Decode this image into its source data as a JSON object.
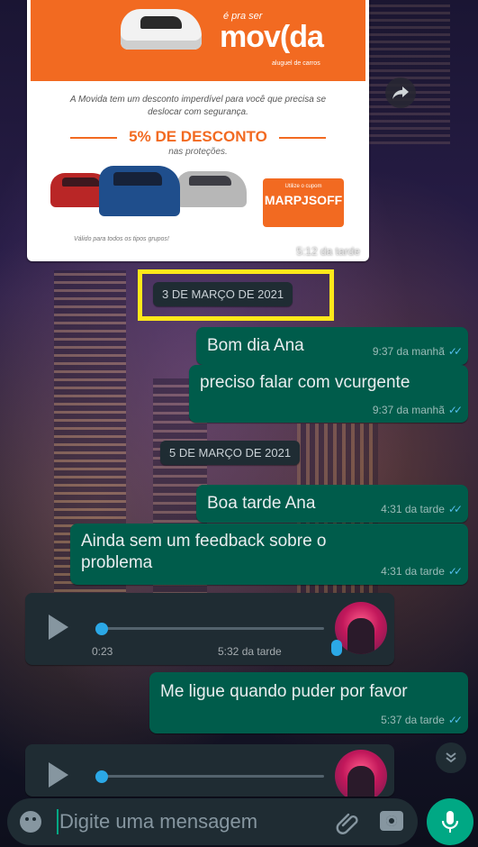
{
  "colors": {
    "outgoing_bubble": "#005c4b",
    "incoming_bubble": "#1f2c33",
    "read_ticks": "#53bdeb",
    "accent_green": "#00a884",
    "highlight_box": "#ffe81a",
    "ad_orange": "#f26a21"
  },
  "image_message": {
    "ad": {
      "tagline": "é pra ser",
      "brand": "mov(da",
      "brand_sub": "aluguel de carros",
      "text": "A Movida tem um desconto imperdível para você que precisa se deslocar com segurança.",
      "discount": "5% DE DESCONTO",
      "discount_sub": "nas proteções.",
      "coupon_small": "Utilize o cupom",
      "coupon_code": "MARPJSOFF",
      "footnote": "Válido para todos os tipos grupos!"
    },
    "time": "5:12 da tarde",
    "forward_icon": "forward-arrow-icon"
  },
  "chat": {
    "date_1": "3 DE MARÇO DE 2021",
    "date_2": "5 DE MARÇO DE 2021",
    "messages": [
      {
        "text": "Bom dia Ana",
        "time": "9:37 da manhã"
      },
      {
        "text": "preciso falar com vcurgente",
        "time": "9:37 da manhã"
      },
      {
        "text": "Boa tarde Ana",
        "time": "4:31 da tarde"
      },
      {
        "text": "Ainda sem um feedback sobre o problema",
        "time": "4:31 da tarde"
      },
      {
        "text": "Me ligue quando puder por favor",
        "time": "5:37 da tarde"
      }
    ],
    "ticks": "✓✓",
    "voice_1": {
      "duration": "0:23",
      "time": "5:32 da tarde",
      "progress": 0
    },
    "voice_2": {
      "progress": 0
    }
  },
  "input": {
    "placeholder": "Digite uma mensagem",
    "value": ""
  },
  "icons": {
    "emoji": "emoji-icon",
    "attach": "paperclip-icon",
    "camera": "camera-icon",
    "mic": "mic-icon",
    "scroll": "double-chevron-down-icon"
  }
}
